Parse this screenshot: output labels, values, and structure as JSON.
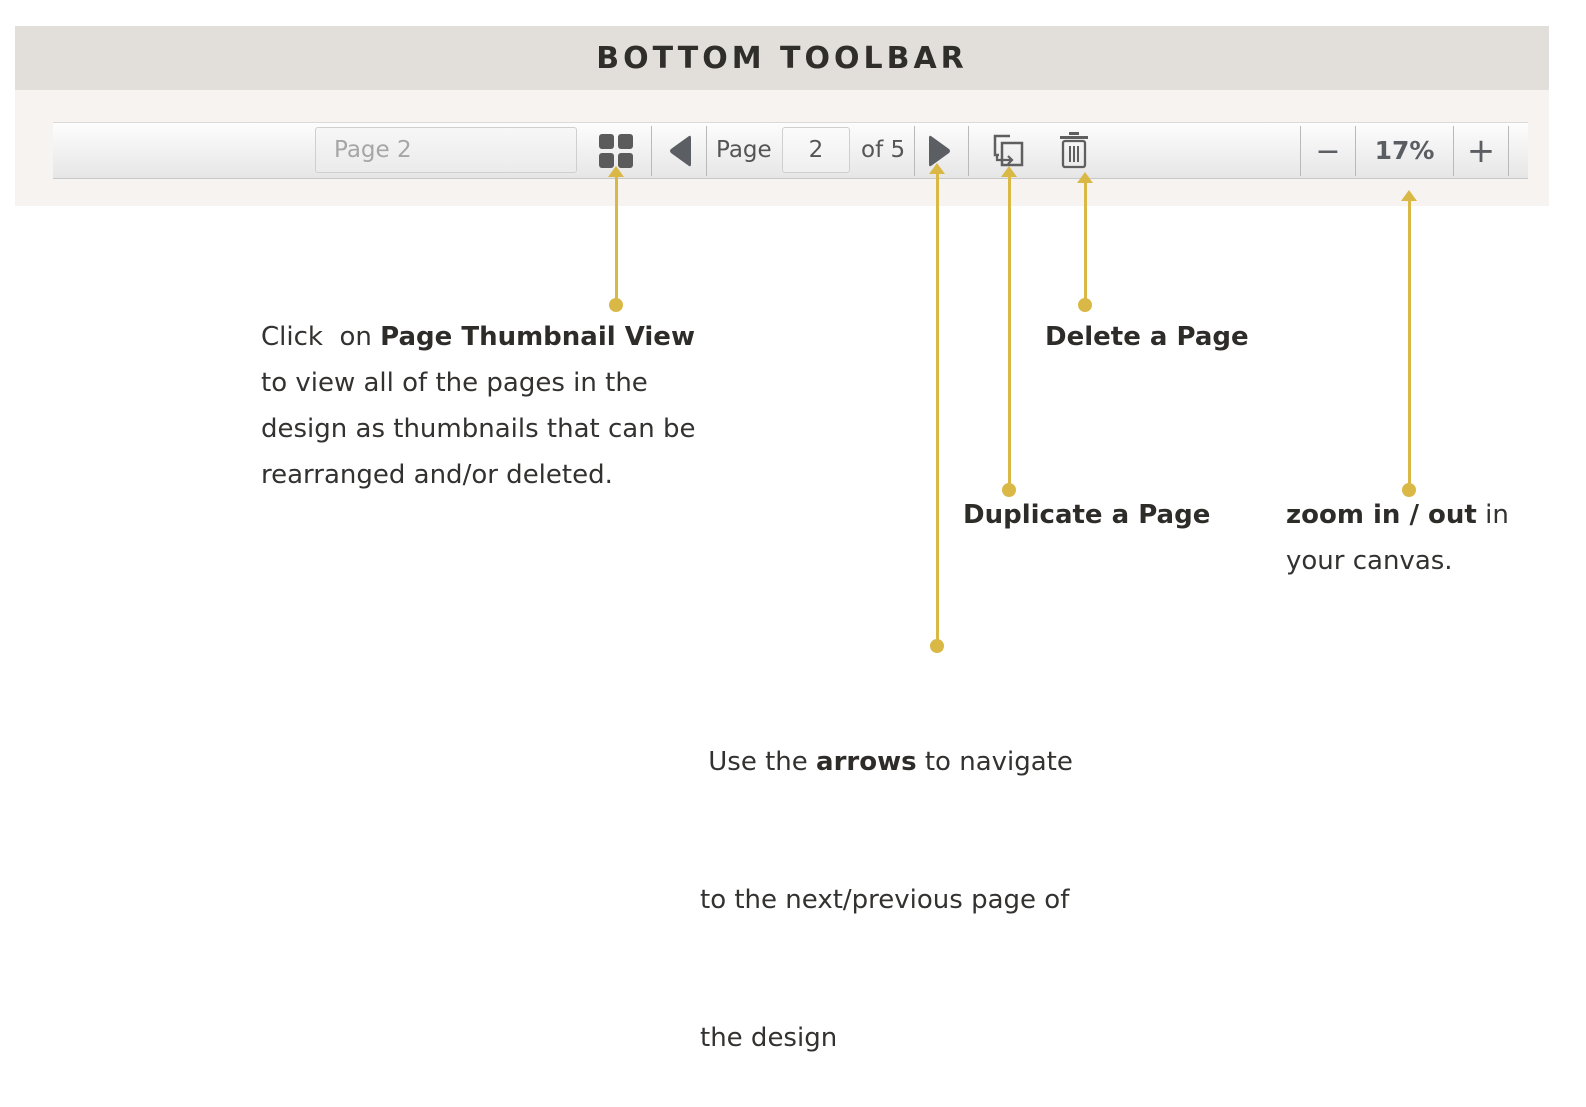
{
  "header": {
    "title": "BOTTOM TOOLBAR"
  },
  "toolbar": {
    "page_name_value": "Page 2",
    "page_label": "Page",
    "current_page": "2",
    "of_total": "of 5",
    "zoom_level": "17%",
    "zoom_out_label": "−",
    "zoom_in_label": "+",
    "icons": {
      "thumbnail_view": "grid-icon",
      "previous": "triangle-left-icon",
      "next": "triangle-right-icon",
      "duplicate": "duplicate-page-icon",
      "delete": "trash-icon"
    }
  },
  "callouts": {
    "thumbnail": {
      "prefix": "Click  on ",
      "bold": "Page Thumbnail View",
      "lines": [
        "to view all of the pages in the",
        "design as thumbnails that can be",
        "rearranged and/or deleted."
      ]
    },
    "arrows": {
      "prefix": " Use the ",
      "bold": "arrows",
      "suffix": " to navigate",
      "lines": [
        "to the next/previous page of",
        "the design"
      ]
    },
    "duplicate": {
      "bold": "Duplicate a Page"
    },
    "delete": {
      "bold": "Delete a Page"
    },
    "zoom": {
      "bold": "zoom in / out",
      "suffix": " in",
      "lines": [
        "your canvas."
      ]
    }
  },
  "colors": {
    "accent": "#d9b845",
    "header_band": "#e2dfda",
    "toolbar_area": "#f6f3f0",
    "icon": "#5b5e63",
    "text": "#333230"
  }
}
